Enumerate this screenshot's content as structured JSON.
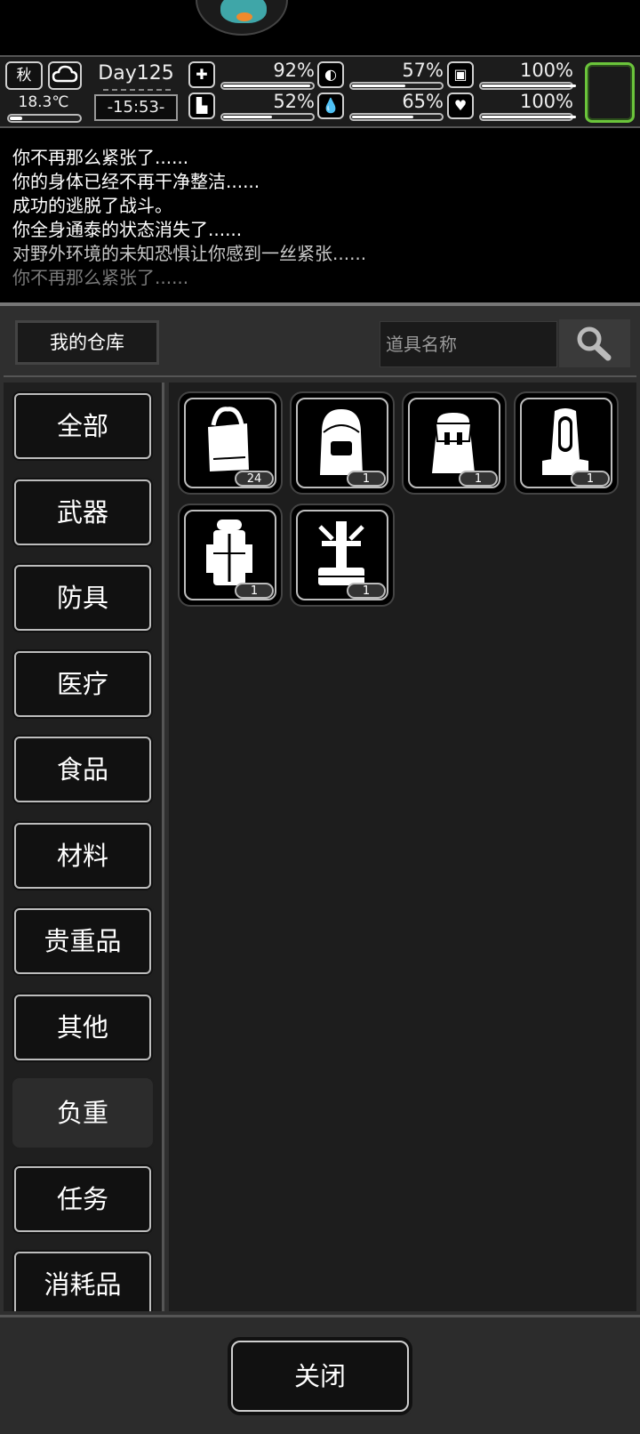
{
  "status": {
    "season": "秋",
    "weather_icon": "cloud-icon",
    "temperature": "18.3℃",
    "temperature_level": 0.18,
    "day": "Day125",
    "time": "-15:53-",
    "stats": [
      {
        "icon": "medkit-icon",
        "value": "92%",
        "level": 0.92
      },
      {
        "icon": "stomach-icon",
        "value": "57%",
        "level": 0.57
      },
      {
        "icon": "pill-icon",
        "value": "100%",
        "level": 1.0
      },
      {
        "icon": "boot-icon",
        "value": "52%",
        "level": 0.52
      },
      {
        "icon": "water-drop-icon",
        "value": "65%",
        "level": 0.65
      },
      {
        "icon": "heart-icon",
        "value": "100%",
        "level": 1.0
      }
    ],
    "accent_color": "#6bc53b"
  },
  "log": [
    {
      "text": "你不再那么紧张了......",
      "color": "#ffffff"
    },
    {
      "text": "你的身体已经不再干净整洁......",
      "color": "#ffffff"
    },
    {
      "text": "成功的逃脱了战斗。",
      "color": "#ffffff"
    },
    {
      "text": "你全身通泰的状态消失了......",
      "color": "#ffffff"
    },
    {
      "text": "对野外环境的未知恐惧让你感到一丝紧张......",
      "color": "#c8c8c8"
    },
    {
      "text": "你不再那么紧张了......",
      "color": "#7a7a7a"
    }
  ],
  "storage": {
    "title": "我的仓库",
    "search_placeholder": "道具名称",
    "categories": [
      {
        "label": "全部",
        "selected": false
      },
      {
        "label": "武器",
        "selected": false
      },
      {
        "label": "防具",
        "selected": false
      },
      {
        "label": "医疗",
        "selected": false
      },
      {
        "label": "食品",
        "selected": false
      },
      {
        "label": "材料",
        "selected": false
      },
      {
        "label": "贵重品",
        "selected": false
      },
      {
        "label": "其他",
        "selected": false
      },
      {
        "label": "负重",
        "selected": true
      },
      {
        "label": "任务",
        "selected": false
      },
      {
        "label": "消耗品",
        "selected": false
      }
    ],
    "items": [
      {
        "icon": "tote-bag-icon",
        "count": "24"
      },
      {
        "icon": "backpack-icon",
        "count": "1"
      },
      {
        "icon": "rucksack-icon",
        "count": "1"
      },
      {
        "icon": "hiking-backpack-icon",
        "count": "1"
      },
      {
        "icon": "large-hiking-pack-icon",
        "count": "1"
      },
      {
        "icon": "frame-pack-icon",
        "count": "1"
      }
    ]
  },
  "footer": {
    "close_label": "关闭"
  }
}
